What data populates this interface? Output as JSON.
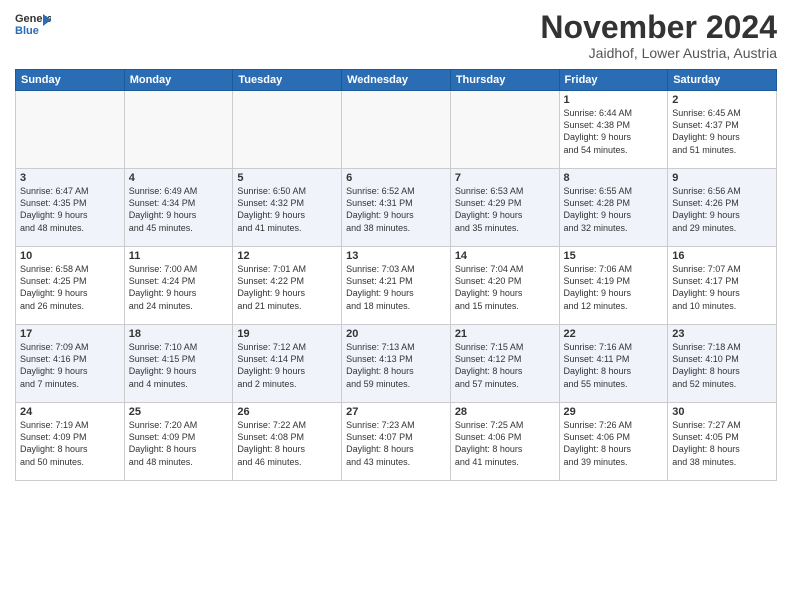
{
  "logo": {
    "line1": "General",
    "line2": "Blue"
  },
  "title": "November 2024",
  "subtitle": "Jaidhof, Lower Austria, Austria",
  "days_of_week": [
    "Sunday",
    "Monday",
    "Tuesday",
    "Wednesday",
    "Thursday",
    "Friday",
    "Saturday"
  ],
  "weeks": [
    [
      {
        "day": "",
        "info": ""
      },
      {
        "day": "",
        "info": ""
      },
      {
        "day": "",
        "info": ""
      },
      {
        "day": "",
        "info": ""
      },
      {
        "day": "",
        "info": ""
      },
      {
        "day": "1",
        "info": "Sunrise: 6:44 AM\nSunset: 4:38 PM\nDaylight: 9 hours\nand 54 minutes."
      },
      {
        "day": "2",
        "info": "Sunrise: 6:45 AM\nSunset: 4:37 PM\nDaylight: 9 hours\nand 51 minutes."
      }
    ],
    [
      {
        "day": "3",
        "info": "Sunrise: 6:47 AM\nSunset: 4:35 PM\nDaylight: 9 hours\nand 48 minutes."
      },
      {
        "day": "4",
        "info": "Sunrise: 6:49 AM\nSunset: 4:34 PM\nDaylight: 9 hours\nand 45 minutes."
      },
      {
        "day": "5",
        "info": "Sunrise: 6:50 AM\nSunset: 4:32 PM\nDaylight: 9 hours\nand 41 minutes."
      },
      {
        "day": "6",
        "info": "Sunrise: 6:52 AM\nSunset: 4:31 PM\nDaylight: 9 hours\nand 38 minutes."
      },
      {
        "day": "7",
        "info": "Sunrise: 6:53 AM\nSunset: 4:29 PM\nDaylight: 9 hours\nand 35 minutes."
      },
      {
        "day": "8",
        "info": "Sunrise: 6:55 AM\nSunset: 4:28 PM\nDaylight: 9 hours\nand 32 minutes."
      },
      {
        "day": "9",
        "info": "Sunrise: 6:56 AM\nSunset: 4:26 PM\nDaylight: 9 hours\nand 29 minutes."
      }
    ],
    [
      {
        "day": "10",
        "info": "Sunrise: 6:58 AM\nSunset: 4:25 PM\nDaylight: 9 hours\nand 26 minutes."
      },
      {
        "day": "11",
        "info": "Sunrise: 7:00 AM\nSunset: 4:24 PM\nDaylight: 9 hours\nand 24 minutes."
      },
      {
        "day": "12",
        "info": "Sunrise: 7:01 AM\nSunset: 4:22 PM\nDaylight: 9 hours\nand 21 minutes."
      },
      {
        "day": "13",
        "info": "Sunrise: 7:03 AM\nSunset: 4:21 PM\nDaylight: 9 hours\nand 18 minutes."
      },
      {
        "day": "14",
        "info": "Sunrise: 7:04 AM\nSunset: 4:20 PM\nDaylight: 9 hours\nand 15 minutes."
      },
      {
        "day": "15",
        "info": "Sunrise: 7:06 AM\nSunset: 4:19 PM\nDaylight: 9 hours\nand 12 minutes."
      },
      {
        "day": "16",
        "info": "Sunrise: 7:07 AM\nSunset: 4:17 PM\nDaylight: 9 hours\nand 10 minutes."
      }
    ],
    [
      {
        "day": "17",
        "info": "Sunrise: 7:09 AM\nSunset: 4:16 PM\nDaylight: 9 hours\nand 7 minutes."
      },
      {
        "day": "18",
        "info": "Sunrise: 7:10 AM\nSunset: 4:15 PM\nDaylight: 9 hours\nand 4 minutes."
      },
      {
        "day": "19",
        "info": "Sunrise: 7:12 AM\nSunset: 4:14 PM\nDaylight: 9 hours\nand 2 minutes."
      },
      {
        "day": "20",
        "info": "Sunrise: 7:13 AM\nSunset: 4:13 PM\nDaylight: 8 hours\nand 59 minutes."
      },
      {
        "day": "21",
        "info": "Sunrise: 7:15 AM\nSunset: 4:12 PM\nDaylight: 8 hours\nand 57 minutes."
      },
      {
        "day": "22",
        "info": "Sunrise: 7:16 AM\nSunset: 4:11 PM\nDaylight: 8 hours\nand 55 minutes."
      },
      {
        "day": "23",
        "info": "Sunrise: 7:18 AM\nSunset: 4:10 PM\nDaylight: 8 hours\nand 52 minutes."
      }
    ],
    [
      {
        "day": "24",
        "info": "Sunrise: 7:19 AM\nSunset: 4:09 PM\nDaylight: 8 hours\nand 50 minutes."
      },
      {
        "day": "25",
        "info": "Sunrise: 7:20 AM\nSunset: 4:09 PM\nDaylight: 8 hours\nand 48 minutes."
      },
      {
        "day": "26",
        "info": "Sunrise: 7:22 AM\nSunset: 4:08 PM\nDaylight: 8 hours\nand 46 minutes."
      },
      {
        "day": "27",
        "info": "Sunrise: 7:23 AM\nSunset: 4:07 PM\nDaylight: 8 hours\nand 43 minutes."
      },
      {
        "day": "28",
        "info": "Sunrise: 7:25 AM\nSunset: 4:06 PM\nDaylight: 8 hours\nand 41 minutes."
      },
      {
        "day": "29",
        "info": "Sunrise: 7:26 AM\nSunset: 4:06 PM\nDaylight: 8 hours\nand 39 minutes."
      },
      {
        "day": "30",
        "info": "Sunrise: 7:27 AM\nSunset: 4:05 PM\nDaylight: 8 hours\nand 38 minutes."
      }
    ]
  ]
}
